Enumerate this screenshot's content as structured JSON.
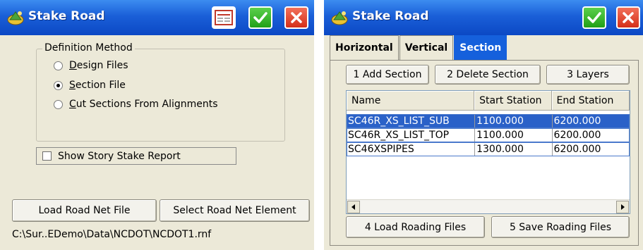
{
  "left_window": {
    "title": "Stake Road",
    "group_title": "Definition Method",
    "options": [
      {
        "label": "Design Files",
        "checked": false
      },
      {
        "label": "Section File",
        "checked": true
      },
      {
        "label": "Cut Sections From Alignments",
        "checked": false
      }
    ],
    "checkbox_label": "Show Story Stake Report",
    "checkbox_checked": false,
    "load_button": "Load Road Net File",
    "select_button": "Select Road Net Element",
    "file_path": "C:\\Sur..EDemo\\Data\\NCDOT\\NCDOT1.rnf"
  },
  "right_window": {
    "title": "Stake Road",
    "tabs": [
      "Horizontal",
      "Vertical",
      "Section"
    ],
    "active_tab": "Section",
    "buttons": [
      "1 Add Section",
      "2 Delete Section",
      "3 Layers"
    ],
    "columns": [
      "Name",
      "Start Station",
      "End Station"
    ],
    "rows": [
      {
        "name": "SC46R_XS_LIST_SUB",
        "start": "1100.000",
        "end": "6200.000",
        "selected": true
      },
      {
        "name": "SC46R_XS_LIST_TOP",
        "start": "1100.000",
        "end": "6200.000",
        "selected": false
      },
      {
        "name": "SC46XSPIPES",
        "start": "1300.000",
        "end": "6200.000",
        "selected": false
      }
    ],
    "load_roading": "4 Load Roading Files",
    "save_roading": "5 Save Roading Files"
  },
  "colors": {
    "titlebar": "#0b48c4",
    "ok_button": "#21a016",
    "close_button": "#d42f18",
    "selection": "#2a61c8",
    "window_bg": "#ece9d8"
  },
  "icons": {
    "app": "road-app-icon",
    "ok": "check-icon",
    "close": "close-icon",
    "report": "report-icon",
    "scroll_left": "arrow-left-icon",
    "scroll_right": "arrow-right-icon"
  }
}
